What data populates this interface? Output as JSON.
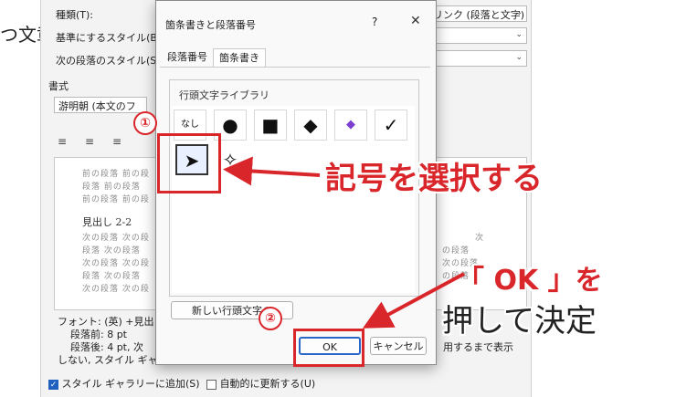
{
  "background": {
    "doc_text": "つ文章",
    "style_dialog": {
      "type_label": "種類(T):",
      "type_value": "リンク (段落と文字)",
      "base_label": "基準にするスタイル(B):",
      "next_label": "次の段落のスタイル(S):",
      "format_label": "書式",
      "font_value": "游明朝 (本文のフ",
      "preview": {
        "prev_lines": [
          "前の段落 前の段",
          "段落 前の段落",
          "前の段落 前の段"
        ],
        "heading": "見出し 2-2",
        "next_lines": [
          "次の段落 次の段",
          "段落 次の段落",
          "次の段落 次の段",
          "段落 次の段落",
          "次の段落 次の段"
        ],
        "right_lines": [
          "次",
          "の段落",
          "次の段落",
          "の段落"
        ]
      },
      "description": [
        "フォント: (英) +見出し",
        "段落前: 8 pt",
        "段落後: 4 pt, 次",
        "しない, スタイル ギャラリー"
      ],
      "description_tail": "用するまで表示",
      "add_gallery_label": "スタイル ギャラリーに追加(S)",
      "auto_update_label": "自動的に更新する(U)"
    }
  },
  "dialog": {
    "title": "箇条書きと段落番号",
    "help": "?",
    "close": "✕",
    "tabs": [
      {
        "label": "段落番号",
        "active": false
      },
      {
        "label": "箇条書き",
        "active": true
      }
    ],
    "library_title": "行頭文字ライブラリ",
    "bullets_row1": [
      {
        "glyph": "なし",
        "name": "none"
      },
      {
        "glyph": "●",
        "name": "circle"
      },
      {
        "glyph": "■",
        "name": "square"
      },
      {
        "glyph": "◆",
        "name": "diamond"
      },
      {
        "glyph": "◆",
        "name": "color-star"
      },
      {
        "glyph": "✓",
        "name": "checkmark"
      }
    ],
    "bullets_row2": [
      {
        "glyph": "➤",
        "name": "arrow",
        "selected": true
      },
      {
        "glyph": "✧",
        "name": "star-outline"
      }
    ],
    "new_bullet_button": "新しい行頭文字の",
    "ok_button": "OK",
    "cancel_button": "キャンセル"
  },
  "annotations": {
    "step1": "①",
    "step2": "②",
    "select_text": "記号を選択する",
    "ok_text": "「 OK 」を",
    "confirm_text": "押して決定"
  },
  "colors": {
    "annotation_red": "#d9262b",
    "default_button_border": "#2b67c8"
  }
}
